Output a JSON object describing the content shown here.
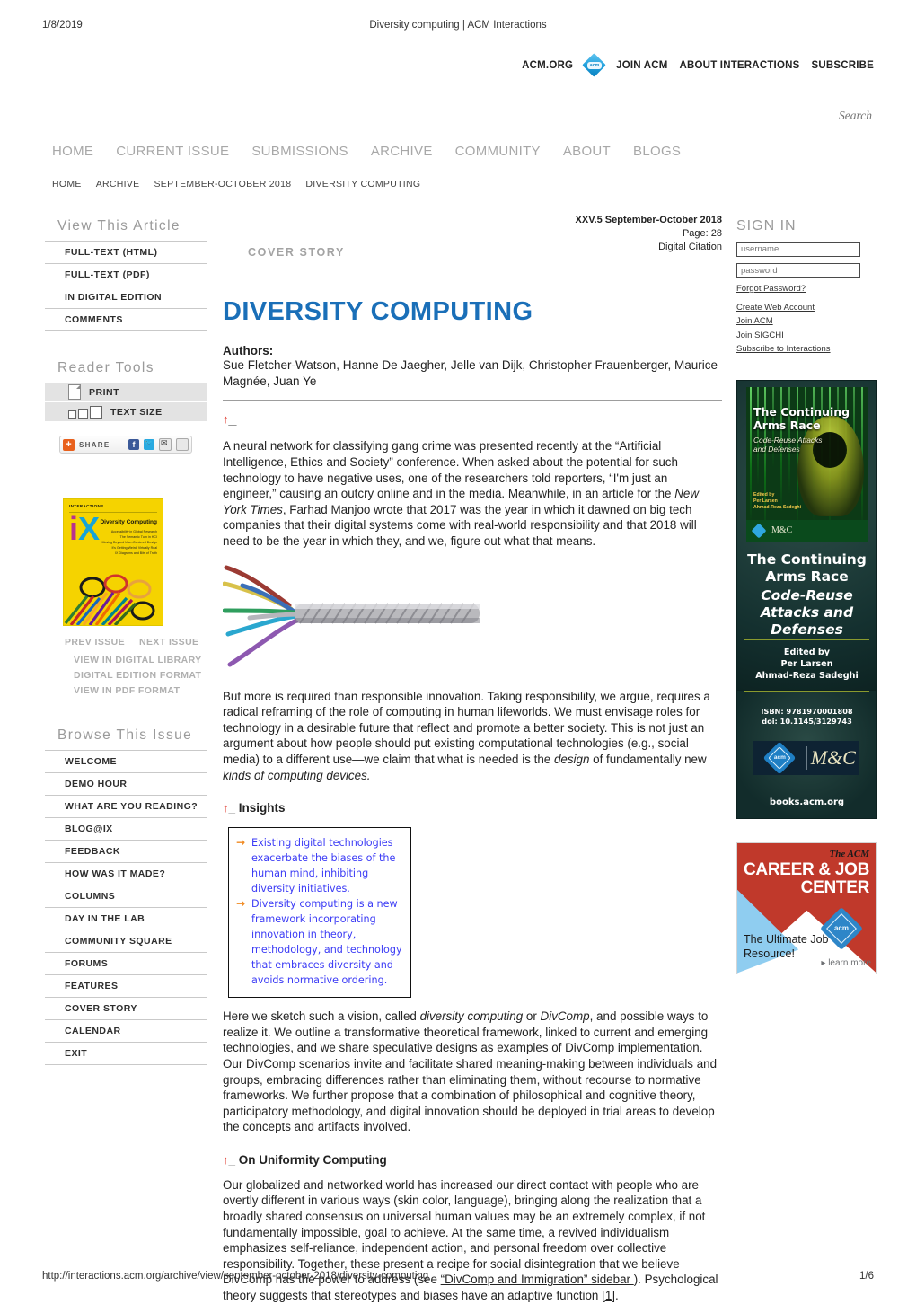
{
  "print": {
    "date": "1/8/2019",
    "doc_title": "Diversity computing | ACM Interactions",
    "url": "http://interactions.acm.org/archive/view/september-october-2018/diversity-computing",
    "page_number": "1/6"
  },
  "util_nav": {
    "items": [
      "ACM.ORG",
      "JOIN ACM",
      "ABOUT INTERACTIONS",
      "SUBSCRIBE"
    ],
    "logo_text": "acm"
  },
  "search": {
    "placeholder": "Search",
    "value": ""
  },
  "main_nav": [
    "HOME",
    "CURRENT ISSUE",
    "SUBMISSIONS",
    "ARCHIVE",
    "COMMUNITY",
    "ABOUT",
    "BLOGS"
  ],
  "breadcrumb": [
    "HOME",
    "ARCHIVE",
    "SEPTEMBER-OCTOBER 2018",
    "DIVERSITY COMPUTING"
  ],
  "view_article": {
    "title": "View This Article",
    "items": [
      "FULL-TEXT (HTML)",
      "FULL-TEXT (PDF)",
      "IN DIGITAL EDITION",
      "COMMENTS"
    ]
  },
  "reader_tools": {
    "title": "Reader Tools",
    "print_label": "PRINT",
    "text_size_label": "TEXT SIZE",
    "share_label": "SHARE",
    "share_plus": "+",
    "facebook": "f"
  },
  "magazine_cover": {
    "masthead": "INTERACTIONS",
    "logo_i": "i",
    "logo_x": "X",
    "headline": "Diversity Computing",
    "sublines": "Accessibility in Global Research\nThe Semantic Turn in HCI\nMoving Beyond User-Centered Design\nIt's Getting Weird: Virtually Real\nIX Diagrams and Bits of Truth"
  },
  "issue_nav": {
    "prev": "PREV ISSUE",
    "next": "NEXT ISSUE",
    "links": [
      "VIEW IN DIGITAL LIBRARY",
      "DIGITAL EDITION FORMAT",
      "VIEW IN PDF FORMAT"
    ]
  },
  "browse_issue": {
    "title": "Browse This Issue",
    "items": [
      "WELCOME",
      "DEMO HOUR",
      "WHAT ARE YOU READING?",
      "BLOG@IX",
      "FEEDBACK",
      "HOW WAS IT MADE?",
      "COLUMNS",
      "DAY IN THE LAB",
      "COMMUNITY SQUARE",
      "FORUMS",
      "FEATURES",
      "COVER STORY",
      "CALENDAR",
      "EXIT"
    ]
  },
  "article": {
    "issue_line": "XXV.5 September-October 2018",
    "page_line": "Page: 28",
    "citation_link": "Digital Citation",
    "kicker": "COVER STORY",
    "title": "DIVERSITY COMPUTING",
    "authors_label": "Authors:",
    "authors": "Sue Fletcher-Watson, Hanne De Jaegher, Jelle van Dijk, Christopher Frauenberger, Maurice Magnée, Juan Ye",
    "anchor": "↑",
    "para1_a": "A neural network for classifying gang crime was presented recently at the “Artificial Intelligence, Ethics and Society” conference. When asked about the potential for such technology to have negative uses, one of the researchers told reporters, “I'm just an engineer,” causing an outcry online and in the media. Meanwhile, in an article for the ",
    "para1_em": "New York Times",
    "para1_b": ", Farhad Manjoo wrote that 2017 was the year in which it dawned on big tech companies that their digital systems come with real-world responsibility and that 2018 will need to be the year in which they, and we, figure out what that means.",
    "para2_a": "But more is required than responsible innovation. Taking responsibility, we argue, requires a radical reframing of the role of computing in human lifeworlds. We must envisage roles for technology in a desirable future that reflect and promote a better society. This is not just an argument about how people should put existing computational technologies (e.g., social media) to a different use—we claim that what is needed is the ",
    "para2_em1": "design",
    "para2_b": " of fundamentally new ",
    "para2_em2": "kinds of computing devices.",
    "insights_heading": "Insights",
    "insights": [
      "Existing digital technologies exacerbate the biases of the human mind, inhibiting diversity initiatives.",
      "Diversity computing is a new framework incorporating innovation in theory, methodology, and technology that embraces diversity and avoids normative ordering."
    ],
    "para3_a": "Here we sketch such a vision, called ",
    "para3_em1": "diversity computing",
    "para3_b": " or ",
    "para3_em2": "DivComp",
    "para3_c": ", and possible ways to realize it. We outline a transformative theoretical framework, linked to current and emerging technologies, and we share speculative designs as examples of DivComp implementation. Our DivComp scenarios invite and facilitate shared meaning-making between individuals and groups, embracing differences rather than eliminating them, without recourse to normative frameworks. We further propose that a combination of philosophical and cognitive theory, participatory methodology, and digital innovation should be deployed in trial areas to develop the concepts and artifacts involved.",
    "section2_heading": "On Uniformity Computing",
    "para4_a": "Our globalized and networked world has increased our direct contact with people who are overtly different in various ways (skin color, language), bringing along the realization that a broadly shared consensus on universal human values may be an extremely complex, if not fundamentally impossible, goal to achieve. At the same time, a revived individualism emphasizes self-reliance, independent action, and personal freedom over collective responsibility. Together, these present a recipe for social disintegration that we believe DivComp has the power to address (see ",
    "para4_link": "“DivComp and Immigration” sidebar ",
    "para4_b": "). Psychological theory suggests that stereotypes and biases have an adaptive function ",
    "para4_ref": "[1]",
    "para4_c": "."
  },
  "sign_in": {
    "title": "SIGN IN",
    "username_placeholder": "username",
    "password_placeholder": "password",
    "forgot": "Forgot Password?",
    "links": [
      "Create Web Account",
      "Join ACM",
      "Join SIGCHI",
      "Subscribe to Interactions"
    ]
  },
  "ads": {
    "arms_race": {
      "cover_title": "The Continuing Arms Race",
      "cover_subtitle": "Code-Reuse Attacks and Defenses",
      "cover_edited": "Edited by\nPer Larsen\nAhmad-Reza Sadeghi",
      "big_title": "The Continuing Arms Race",
      "big_subtitle": "Code-Reuse Attacks and Defenses",
      "edited_by": "Edited by\nPer Larsen\nAhmad-Reza Sadeghi",
      "isbn": "ISBN: 9781970001808",
      "doi": "doi: 10.1145/3129743",
      "acm_mark": "acm",
      "mc_mark": "M&C",
      "site": "books.acm.org"
    },
    "career": {
      "the_acm": "The ACM",
      "title": "CAREER & JOB CENTER",
      "tagline": "The Ultimate Job Resource!",
      "learn_more": "▸ learn more",
      "acm_mark": "acm"
    }
  },
  "colors": {
    "title_blue": "#1a6fb8",
    "anchor_red": "#e03b2f",
    "insight_blue": "#3b3bf5",
    "insight_arrow": "#f08a22",
    "nav_gray": "#a8a8a8"
  }
}
